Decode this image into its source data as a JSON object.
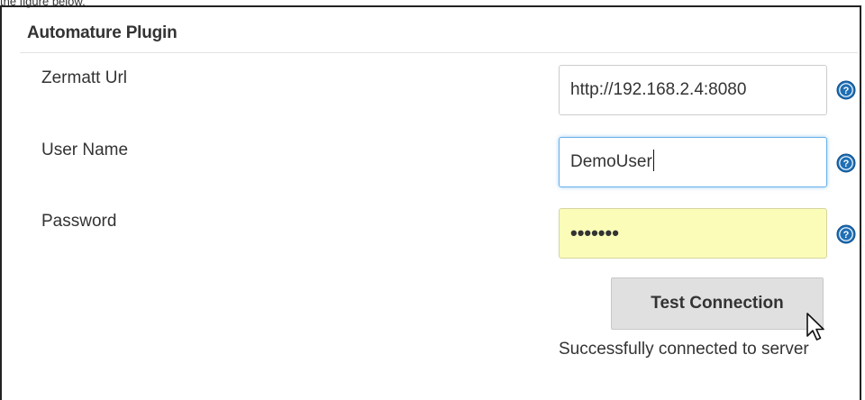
{
  "caption": "the figure below.",
  "section": {
    "title": "Automature Plugin"
  },
  "fields": {
    "zermatt_url": {
      "label": "Zermatt Url",
      "value": "http://192.168.2.4:8080"
    },
    "user_name": {
      "label": "User Name",
      "value": "DemoUser"
    },
    "password": {
      "label": "Password",
      "value": "•••••••"
    }
  },
  "actions": {
    "test_connection_label": "Test Connection"
  },
  "status": {
    "message": "Successfully connected to server"
  },
  "icons": {
    "help": "help-icon",
    "pointer": "mouse-pointer-icon"
  },
  "colors": {
    "help_icon_blue": "#1f6fb5",
    "password_bg": "#fafcb8",
    "focus_border": "#66afe9",
    "button_bg": "#e0e0e0"
  }
}
